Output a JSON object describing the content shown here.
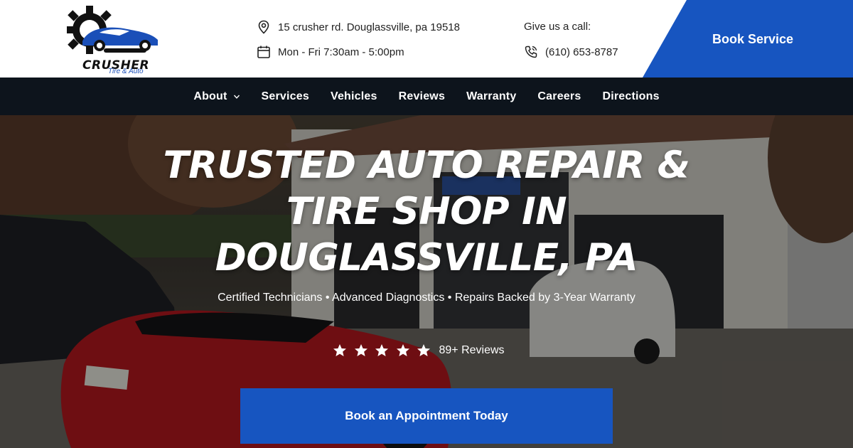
{
  "brand": {
    "name": "CRUSHER",
    "tagline": "Tire & Auto"
  },
  "contact": {
    "address": "15 crusher rd. Douglassville, pa 19518",
    "hours": "Mon - Fri 7:30am - 5:00pm",
    "call_label": "Give us a call:",
    "phone": "(610) 653-8787"
  },
  "header": {
    "book_label": "Book Service"
  },
  "nav": {
    "items": [
      {
        "label": "About"
      },
      {
        "label": "Services"
      },
      {
        "label": "Vehicles"
      },
      {
        "label": "Reviews"
      },
      {
        "label": "Warranty"
      },
      {
        "label": "Careers"
      },
      {
        "label": "Directions"
      }
    ]
  },
  "hero": {
    "title": "TRUSTED AUTO REPAIR & TIRE SHOP IN DOUGLASSVILLE, PA",
    "subtitle": "Certified Technicians • Advanced Diagnostics • Repairs Backed by 3-Year Warranty",
    "rating_stars": 5,
    "reviews_label": "89+ Reviews",
    "cta_label": "Book an Appointment Today"
  },
  "colors": {
    "accent": "#1755c0",
    "nav_bg": "#0d141c",
    "header_bg": "#ffffff"
  },
  "icons": {
    "address": "map-pin-icon",
    "hours": "calendar-icon",
    "phone": "phone-icon",
    "dropdown": "chevron-down-icon",
    "rating": "star-icon"
  }
}
